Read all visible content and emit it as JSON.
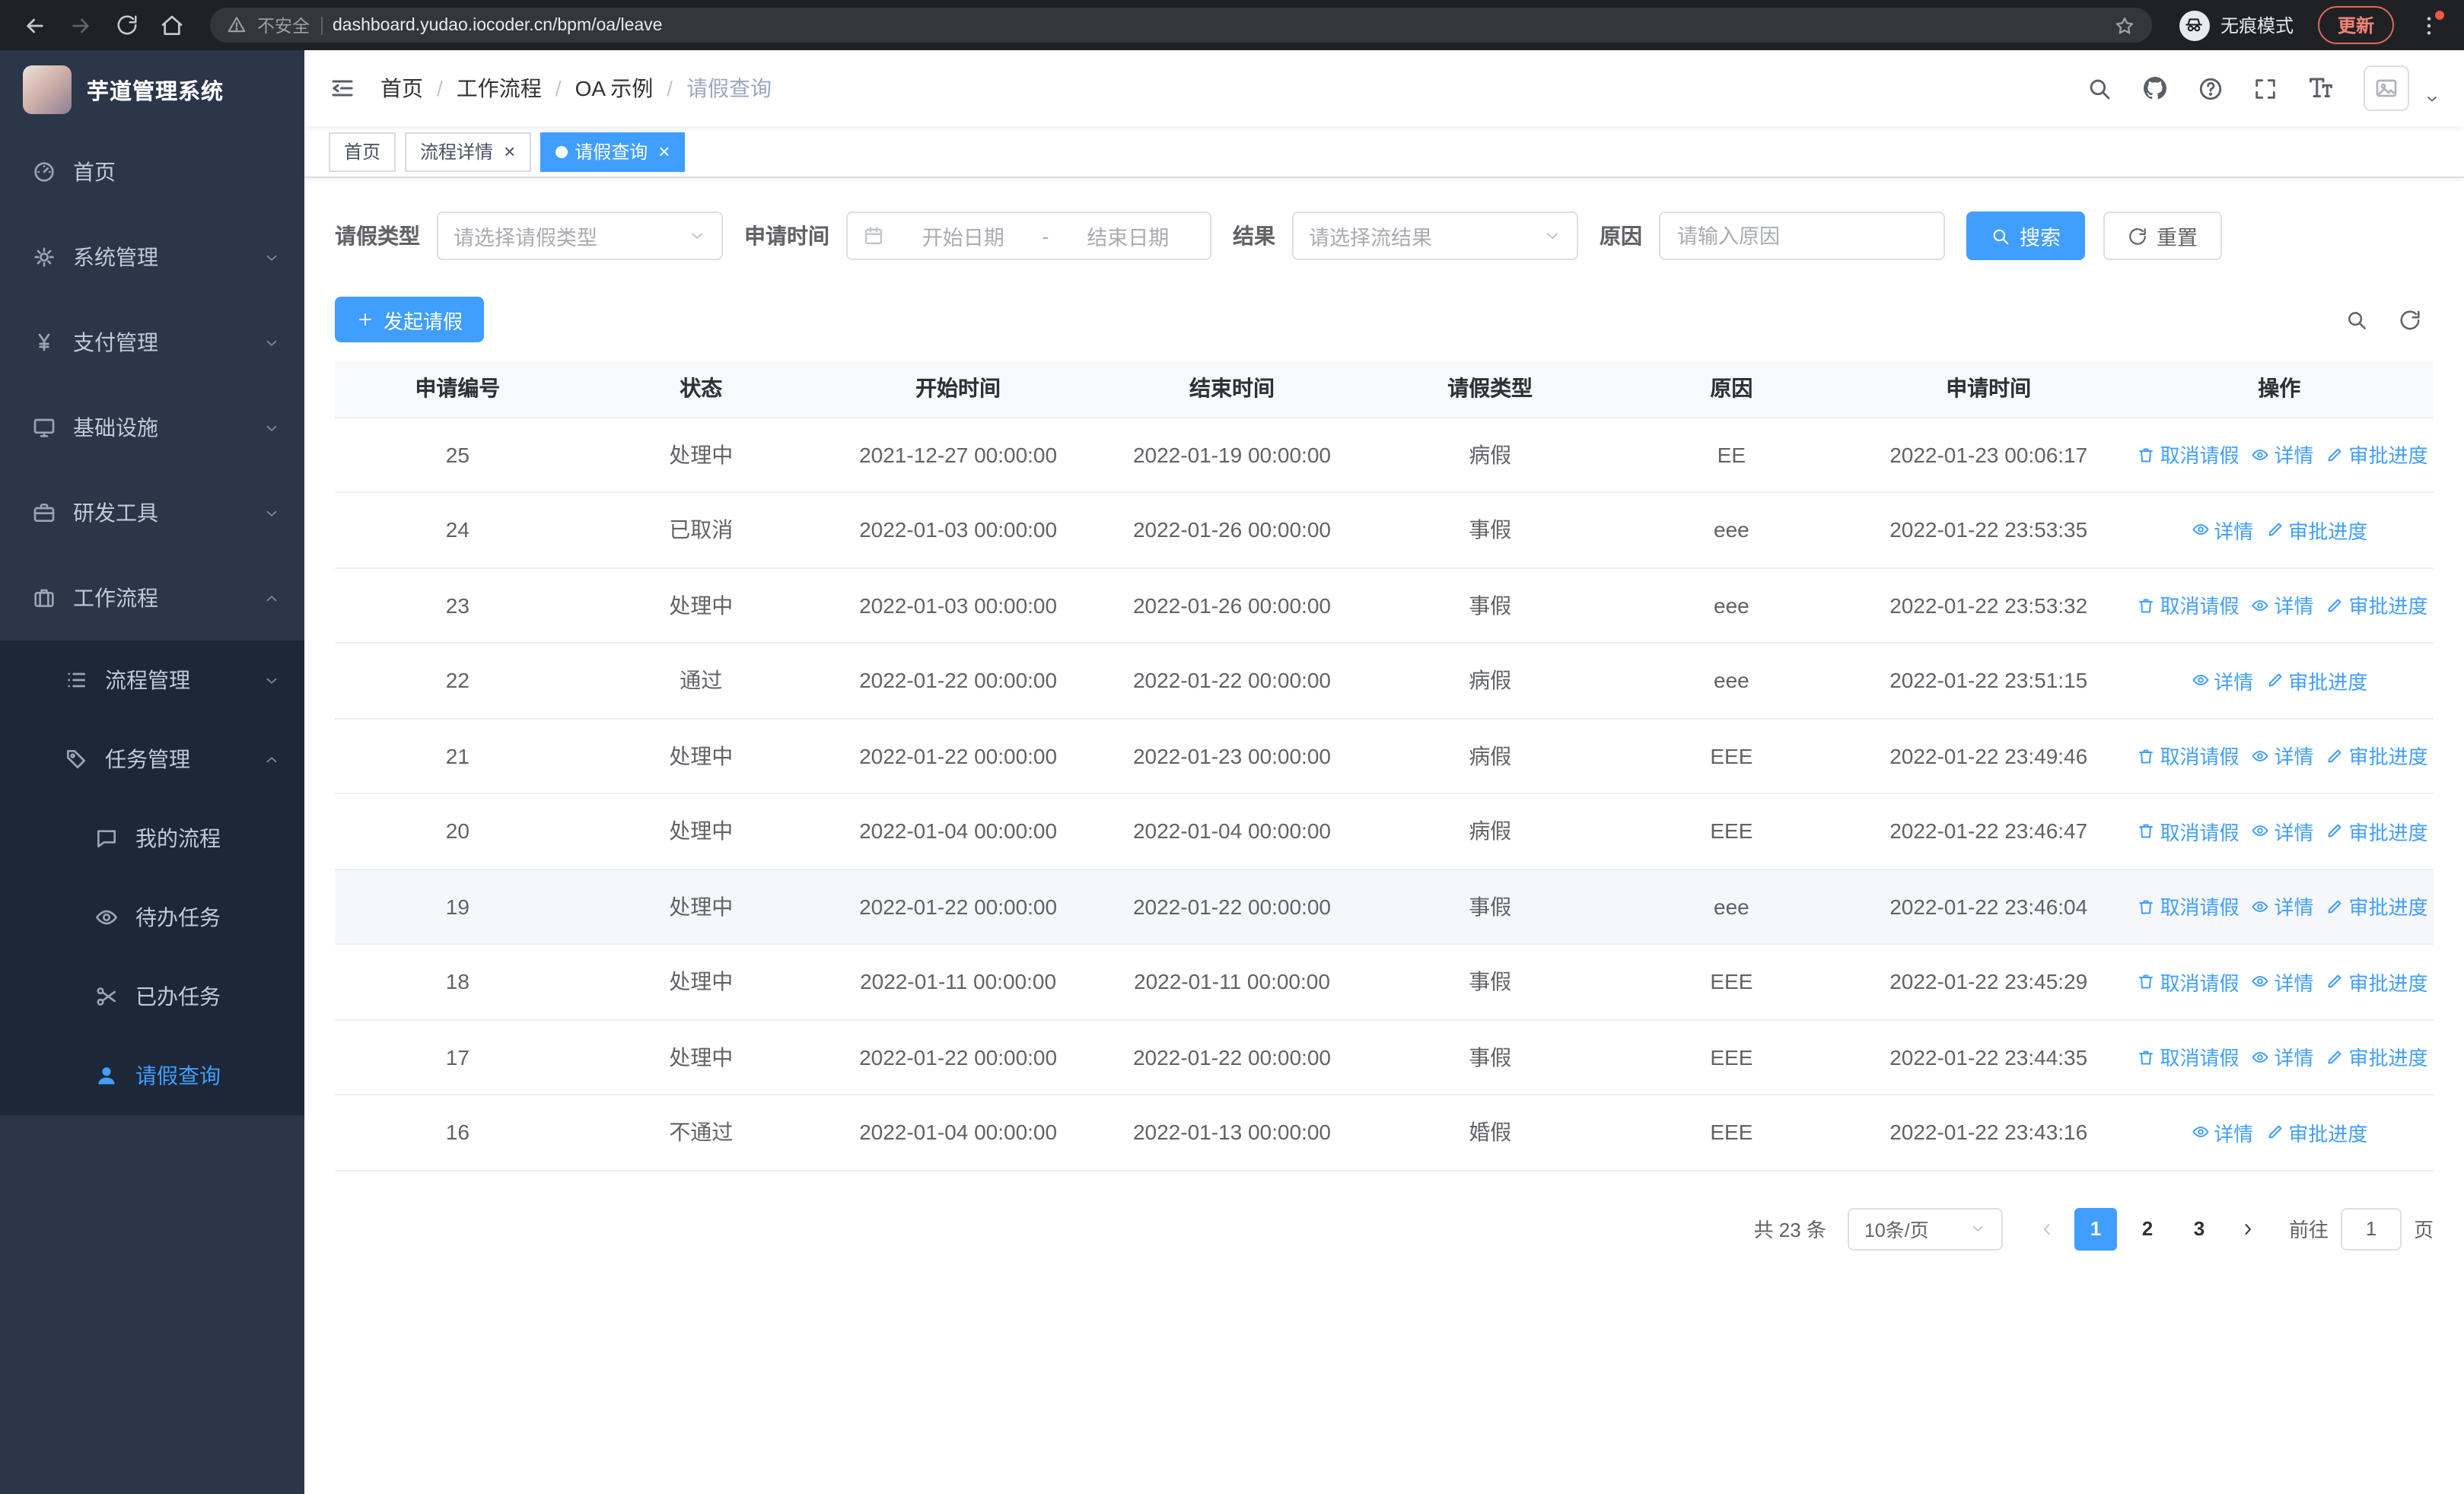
{
  "colors": {
    "accent": "#409eff"
  },
  "browser": {
    "security_warning": "不安全",
    "url": "dashboard.yudao.iocoder.cn/bpm/oa/leave",
    "incognito_label": "无痕模式",
    "update_button": "更新"
  },
  "sidebar": {
    "logo_title": "芋道管理系统",
    "menu": [
      {
        "name": "home",
        "label": "首页",
        "icon": "dashboard"
      },
      {
        "name": "system-management",
        "label": "系统管理",
        "icon": "gear",
        "chevron": "down"
      },
      {
        "name": "payment-management",
        "label": "支付管理",
        "icon": "yen",
        "chevron": "down"
      },
      {
        "name": "infrastructure",
        "label": "基础设施",
        "icon": "monitor",
        "chevron": "down"
      },
      {
        "name": "dev-tools",
        "label": "研发工具",
        "icon": "briefcase",
        "chevron": "down"
      },
      {
        "name": "workflow",
        "label": "工作流程",
        "icon": "suitcase",
        "chevron": "up",
        "children": [
          {
            "name": "process-management",
            "label": "流程管理",
            "icon": "list",
            "chevron": "down"
          },
          {
            "name": "task-management",
            "label": "任务管理",
            "icon": "tag",
            "chevron": "up",
            "children": [
              {
                "name": "my-processes",
                "label": "我的流程",
                "icon": "chat"
              },
              {
                "name": "todo-tasks",
                "label": "待办任务",
                "icon": "eye"
              },
              {
                "name": "done-tasks",
                "label": "已办任务",
                "icon": "scissors"
              },
              {
                "name": "leave-query",
                "label": "请假查询",
                "icon": "user",
                "active": true
              }
            ]
          }
        ]
      }
    ]
  },
  "header": {
    "breadcrumb": [
      "首页",
      "工作流程",
      "OA 示例",
      "请假查询"
    ],
    "breadcrumb_separator": "/",
    "icons": [
      "search-icon",
      "github-icon",
      "help-icon",
      "fullscreen-icon",
      "font-size-icon",
      "avatar"
    ]
  },
  "tabs": [
    {
      "name": "home",
      "label": "首页",
      "closable": false,
      "active": false
    },
    {
      "name": "process-detail",
      "label": "流程详情",
      "closable": true,
      "active": false
    },
    {
      "name": "leave-query",
      "label": "请假查询",
      "closable": true,
      "active": true
    }
  ],
  "filters": {
    "leave_type": {
      "label": "请假类型",
      "placeholder": "请选择请假类型"
    },
    "apply_time": {
      "label": "申请时间",
      "start_placeholder": "开始日期",
      "separator": "-",
      "end_placeholder": "结束日期"
    },
    "result": {
      "label": "结果",
      "placeholder": "请选择流结果"
    },
    "reason": {
      "label": "原因",
      "placeholder": "请输入原因"
    },
    "search_button": "搜索",
    "reset_button": "重置"
  },
  "toolbar": {
    "create_button": "发起请假"
  },
  "table": {
    "columns": [
      "申请编号",
      "状态",
      "开始时间",
      "结束时间",
      "请假类型",
      "原因",
      "申请时间",
      "操作"
    ],
    "actions": {
      "cancel": "取消请假",
      "detail": "详情",
      "progress": "审批进度"
    },
    "rows": [
      {
        "id": "25",
        "status": "处理中",
        "start": "2021-12-27 00:00:00",
        "end": "2022-01-19 00:00:00",
        "type": "病假",
        "reason": "EE",
        "applied": "2022-01-23 00:06:17",
        "can_cancel": true
      },
      {
        "id": "24",
        "status": "已取消",
        "start": "2022-01-03 00:00:00",
        "end": "2022-01-26 00:00:00",
        "type": "事假",
        "reason": "eee",
        "applied": "2022-01-22 23:53:35",
        "can_cancel": false
      },
      {
        "id": "23",
        "status": "处理中",
        "start": "2022-01-03 00:00:00",
        "end": "2022-01-26 00:00:00",
        "type": "事假",
        "reason": "eee",
        "applied": "2022-01-22 23:53:32",
        "can_cancel": true
      },
      {
        "id": "22",
        "status": "通过",
        "start": "2022-01-22 00:00:00",
        "end": "2022-01-22 00:00:00",
        "type": "病假",
        "reason": "eee",
        "applied": "2022-01-22 23:51:15",
        "can_cancel": false
      },
      {
        "id": "21",
        "status": "处理中",
        "start": "2022-01-22 00:00:00",
        "end": "2022-01-23 00:00:00",
        "type": "病假",
        "reason": "EEE",
        "applied": "2022-01-22 23:49:46",
        "can_cancel": true
      },
      {
        "id": "20",
        "status": "处理中",
        "start": "2022-01-04 00:00:00",
        "end": "2022-01-04 00:00:00",
        "type": "病假",
        "reason": "EEE",
        "applied": "2022-01-22 23:46:47",
        "can_cancel": true
      },
      {
        "id": "19",
        "status": "处理中",
        "start": "2022-01-22 00:00:00",
        "end": "2022-01-22 00:00:00",
        "type": "事假",
        "reason": "eee",
        "applied": "2022-01-22 23:46:04",
        "can_cancel": true,
        "hovered": true
      },
      {
        "id": "18",
        "status": "处理中",
        "start": "2022-01-11 00:00:00",
        "end": "2022-01-11 00:00:00",
        "type": "事假",
        "reason": "EEE",
        "applied": "2022-01-22 23:45:29",
        "can_cancel": true
      },
      {
        "id": "17",
        "status": "处理中",
        "start": "2022-01-22 00:00:00",
        "end": "2022-01-22 00:00:00",
        "type": "事假",
        "reason": "EEE",
        "applied": "2022-01-22 23:44:35",
        "can_cancel": true
      },
      {
        "id": "16",
        "status": "不通过",
        "start": "2022-01-04 00:00:00",
        "end": "2022-01-13 00:00:00",
        "type": "婚假",
        "reason": "EEE",
        "applied": "2022-01-22 23:43:16",
        "can_cancel": false
      }
    ]
  },
  "pagination": {
    "total": "共 23 条",
    "page_size": "10条/页",
    "pages": [
      "1",
      "2",
      "3"
    ],
    "active_page": "1",
    "goto_label": "前往",
    "goto_value": "1",
    "page_label": "页"
  }
}
